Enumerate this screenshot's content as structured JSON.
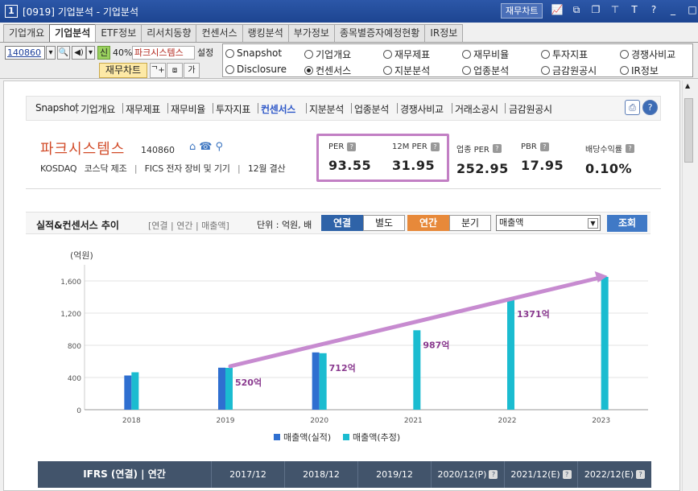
{
  "window": {
    "number": "1",
    "title": "[0919] 기업분석 - 기업분석",
    "chart_button": "재무차트"
  },
  "tabs": [
    {
      "label": "기업개요",
      "active": false
    },
    {
      "label": "기업분석",
      "active": true
    },
    {
      "label": "ETF정보",
      "active": false
    },
    {
      "label": "리서치동향",
      "active": false
    },
    {
      "label": "컨센서스",
      "active": false
    },
    {
      "label": "랭킹분석",
      "active": false
    },
    {
      "label": "부가정보",
      "active": false
    },
    {
      "label": "종목별증자예정현황",
      "active": false
    },
    {
      "label": "IR정보",
      "active": false
    }
  ],
  "toolbar": {
    "code": "140860",
    "sin": "신",
    "pct": "40%",
    "company": "파크시스템스",
    "setting": "설정",
    "fin_chart": "재무차트"
  },
  "radios": [
    {
      "label": "Snapshot",
      "checked": false
    },
    {
      "label": "기업개요",
      "checked": false
    },
    {
      "label": "재무제표",
      "checked": false
    },
    {
      "label": "재무비율",
      "checked": false
    },
    {
      "label": "투자지표",
      "checked": false
    },
    {
      "label": "경쟁사비교",
      "checked": false
    },
    {
      "label": "Disclosure",
      "checked": false
    },
    {
      "label": "컨센서스",
      "checked": true
    },
    {
      "label": "지분분석",
      "checked": false
    },
    {
      "label": "업종분석",
      "checked": false
    },
    {
      "label": "금감원공시",
      "checked": false
    },
    {
      "label": "IR정보",
      "checked": false
    }
  ],
  "subnav": [
    {
      "label": "Snapshot",
      "active": false
    },
    {
      "label": "기업개요",
      "active": false
    },
    {
      "label": "재무제표",
      "active": false
    },
    {
      "label": "재무비율",
      "active": false
    },
    {
      "label": "투자지표",
      "active": false
    },
    {
      "label": "컨센서스",
      "active": true
    },
    {
      "label": "지분분석",
      "active": false
    },
    {
      "label": "업종분석",
      "active": false
    },
    {
      "label": "경쟁사비교",
      "active": false
    },
    {
      "label": "거래소공시",
      "active": false
    },
    {
      "label": "금감원공시",
      "active": false
    }
  ],
  "company": {
    "name": "파크시스템스",
    "code": "140860",
    "market": "KOSDAQ",
    "sector": "코스닥 제조",
    "fics": "FICS 전자 장비 및 기기",
    "fiscal": "12월 결산"
  },
  "metrics": [
    {
      "label": "PER",
      "value": "93.55"
    },
    {
      "label": "12M PER",
      "value": "31.95"
    },
    {
      "label": "업종 PER",
      "value": "252.95"
    },
    {
      "label": "PBR",
      "value": "17.95"
    },
    {
      "label": "배당수익률",
      "value": "0.10%"
    }
  ],
  "section": {
    "title": "실적&컨센서스 추이",
    "subtitle": "[연결 | 연간 | 매출액]",
    "unit": "단위 : 억원, 배",
    "toggle1": [
      "연결",
      "별도"
    ],
    "toggle2": [
      "연간",
      "분기"
    ],
    "select": "매출액",
    "query": "조회"
  },
  "chart_data": {
    "type": "bar",
    "ylabel": "(억원)",
    "ylim": [
      0,
      1800
    ],
    "yticks": [
      "0",
      "400",
      "800",
      "1,200",
      "1,600"
    ],
    "ytick_values": [
      0,
      400,
      800,
      1200,
      1600
    ],
    "categories": [
      "2018",
      "2019",
      "2020",
      "2021",
      "2022",
      "2023"
    ],
    "series": [
      {
        "name": "매출액(실적)",
        "color": "#2f6fd0",
        "values": [
          425,
          522,
          712,
          null,
          null,
          null
        ]
      },
      {
        "name": "매출액(추정)",
        "color": "#1bbcd0",
        "values": [
          465,
          520,
          702,
          987,
          1371,
          1650
        ]
      }
    ],
    "annotations": [
      {
        "category": "2019",
        "label": "520억"
      },
      {
        "category": "2020",
        "label": "712억"
      },
      {
        "category": "2021",
        "label": "987억"
      },
      {
        "category": "2022",
        "label": "1371억"
      }
    ],
    "trend": {
      "from": [
        "2019",
        540
      ],
      "to": [
        "2023",
        1660
      ],
      "color": "#c78bd0"
    },
    "grid": true,
    "legend": "bottom"
  },
  "table_header": {
    "first": "IFRS (연결) | 연간",
    "cols": [
      "2017/12",
      "2018/12",
      "2019/12",
      "2020/12(P)",
      "2021/12(E)",
      "2022/12(E)"
    ]
  }
}
